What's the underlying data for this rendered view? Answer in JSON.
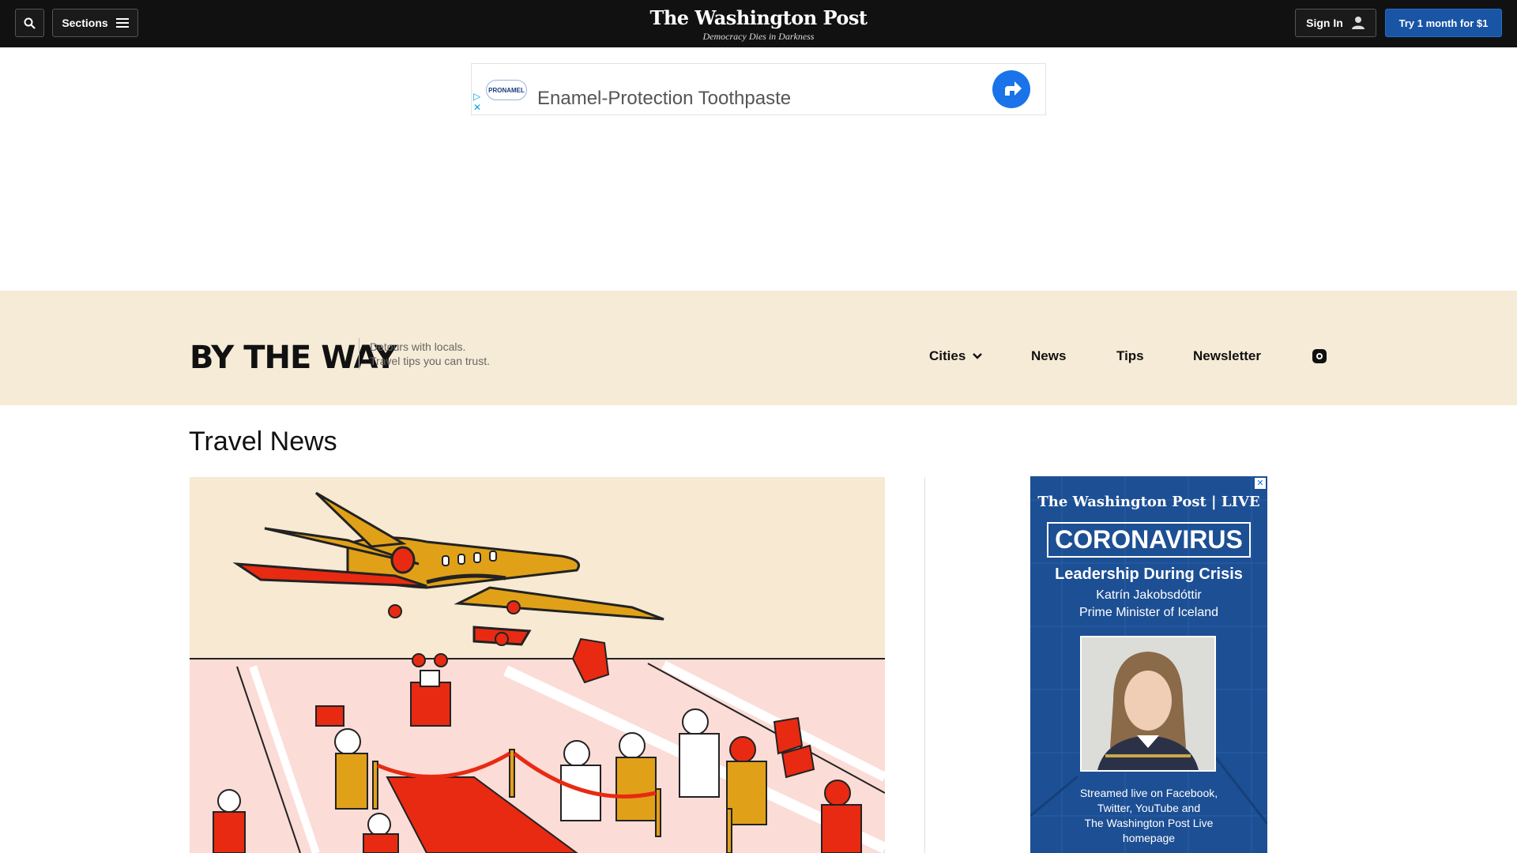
{
  "header": {
    "sections_label": "Sections",
    "logo_title": "The Washington Post",
    "logo_tagline": "Democracy Dies in Darkness",
    "signin_label": "Sign In",
    "subscribe_label": "Try 1 month for $1"
  },
  "ad_banner": {
    "brand_logo_text": "PRONAMEL",
    "text": "Enamel-Protection Toothpaste",
    "adchoices": "▷",
    "close": "✕"
  },
  "brand": {
    "logo": "BY THE WAY",
    "tagline_line1": "Detours with locals.",
    "tagline_line2": "Travel tips you can trust."
  },
  "nav": {
    "items": [
      {
        "label": "Cities"
      },
      {
        "label": "News"
      },
      {
        "label": "Tips"
      },
      {
        "label": "Newsletter"
      }
    ],
    "instagram_icon": "instagram-icon"
  },
  "main": {
    "page_title": "Travel News"
  },
  "side_ad": {
    "close": "✕",
    "logo": "The Washington Post | LIVE",
    "headline": "CORONAVIRUS",
    "subhead": "Leadership During Crisis",
    "guest_name": "Katrín Jakobsdóttir",
    "guest_role": "Prime Minister of Iceland",
    "stream_line1": "Streamed live on Facebook,",
    "stream_line2": "Twitter, YouTube and",
    "stream_line3": "The Washington Post Live",
    "stream_line4": "homepage"
  },
  "colors": {
    "topbar": "#111111",
    "subscribe": "#1955a5",
    "brand_strip": "#f6ebd6",
    "side_ad_bg": "#1d4f94"
  }
}
